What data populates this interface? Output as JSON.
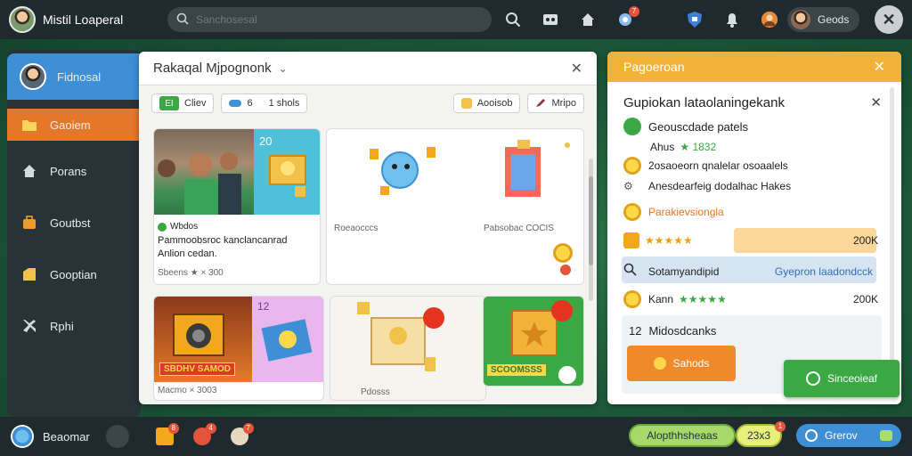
{
  "topbar": {
    "title": "Mistil Loaperal",
    "search_placeholder": "Sanchosesal",
    "icons": [
      "search-icon",
      "gamepad-icon",
      "home-icon",
      "chat-icon",
      "shield-icon",
      "bell-icon",
      "avatar-icon"
    ],
    "chat_badge": "7",
    "profile_label": "Geods"
  },
  "sidebar": {
    "items": [
      {
        "label": "Fidnosal",
        "icon": "avatar"
      },
      {
        "label": "Gaoiem",
        "icon": "folder-icon"
      },
      {
        "label": "Porans",
        "icon": "home-icon"
      },
      {
        "label": "Goutbst",
        "icon": "briefcase-icon"
      },
      {
        "label": "Gooptian",
        "icon": "tag-icon"
      },
      {
        "label": "Rphi",
        "icon": "puzzle-icon"
      }
    ]
  },
  "main": {
    "title": "Rakaqal Mjpognonk",
    "filters": {
      "first_tag": "EI",
      "first_label": "Cliev",
      "second_prefix": "6",
      "second_label": "1 shols",
      "right1": "Aooisob",
      "right2": "Mripo"
    },
    "cards": [
      {
        "badge": "20",
        "tag": "Wbdos",
        "title": "Pammoobsroc kanclancanrad Anlion cedan.",
        "sub": "Sbeens  ★ × 300"
      },
      {
        "label": "Roeaocccs"
      },
      {
        "label": "Pabsobac COCIS"
      },
      {
        "badge": "12",
        "label": "SBDHV SAMOD",
        "sub": "Macmo × 3003"
      },
      {
        "label": "Pdosss"
      },
      {
        "label": "SCOOMSSS"
      }
    ]
  },
  "right": {
    "header": "Pagoeroan",
    "title": "Gupiokan lataolaningekank",
    "rows": {
      "r1": "Geouscdade patels",
      "r2_label": "Ahus",
      "r2_value": "★ 1832",
      "r3": "2osaoeorn qnalelar osoaalels",
      "r4": "Anesdearfeig dodalhac Hakes",
      "r5": "Parakievsiongla",
      "r6_value": "200K",
      "r7_label": "Sotamyandipid",
      "r7_link": "Gyepron laadondcck",
      "r8_label": "Kann",
      "r8_value": "200K",
      "r9_count": "12",
      "r9_label": "Midosdcanks",
      "btn_orange": "Sahods",
      "btn_green": "Sinceoieaf"
    }
  },
  "bottom": {
    "left_label": "Beaomar",
    "badges": [
      "8",
      "4",
      "7"
    ],
    "green_pill": "Alopthhsheaas",
    "count_pill": "23x3",
    "count_badge": "1",
    "blue_pill": "Grerov"
  },
  "colors": {
    "accent_orange": "#e5772a",
    "accent_blue": "#3f8fd7",
    "accent_green": "#3aa843",
    "accent_yellow": "#f2b23a"
  }
}
